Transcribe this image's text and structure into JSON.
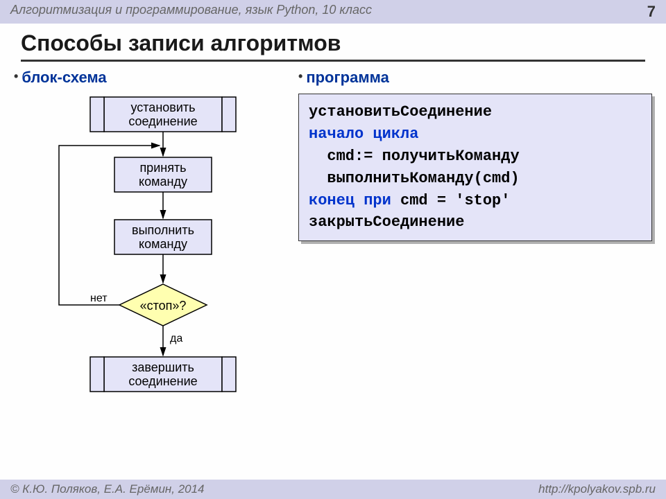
{
  "header": {
    "course": "Алгоритмизация и программирование, язык Python, 10 класс",
    "page_num": "7"
  },
  "title": "Способы записи алгоритмов",
  "subtitle_left": "блок-схема",
  "subtitle_right": "программа",
  "flowchart": {
    "box1_l1": "установить",
    "box1_l2": "соединение",
    "box2_l1": "принять",
    "box2_l2": "команду",
    "box3_l1": "выполнить",
    "box3_l2": "команду",
    "diamond": "«стоп»?",
    "no_label": "нет",
    "yes_label": "да",
    "box4_l1": "завершить",
    "box4_l2": "соединение"
  },
  "code": {
    "l1": "установитьСоединение",
    "l2": "начало цикла",
    "l3": "  cmd:= получитьКоманду",
    "l4": "  выполнитьКоманду(cmd)",
    "l5a": "конец при",
    "l5b": " cmd = 'stop'",
    "l6": "закрытьСоединение"
  },
  "footer": {
    "authors": "© К.Ю. Поляков, Е.А. Ерёмин, 2014",
    "url": "http://kpolyakov.spb.ru"
  }
}
